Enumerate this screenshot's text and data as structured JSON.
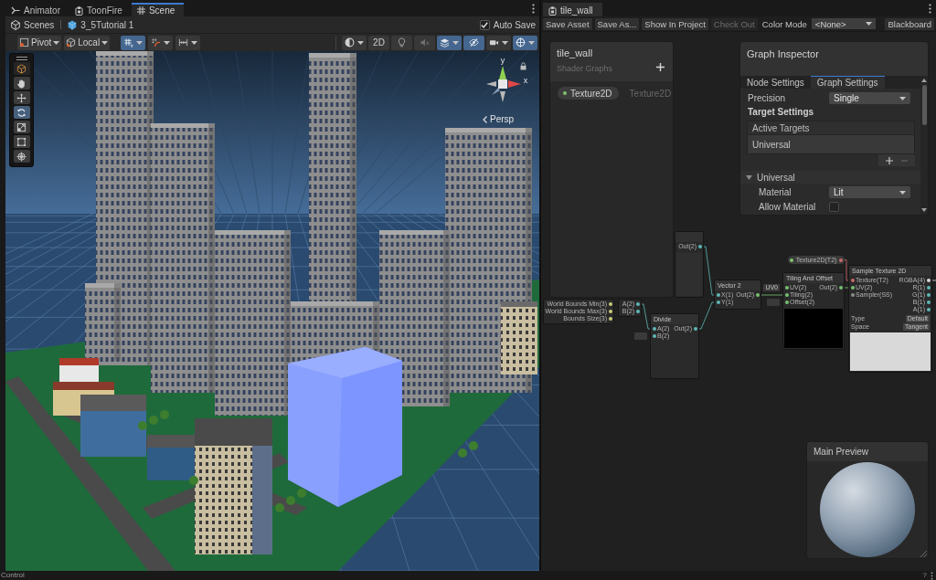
{
  "left_pane": {
    "focused": true,
    "tabs": [
      {
        "label": "Animator",
        "selected": false
      },
      {
        "label": "ToonFire",
        "selected": false
      },
      {
        "label": "Scene",
        "selected": true
      }
    ],
    "breadcrumbs": [
      "Scenes",
      "3_5Tutorial 1"
    ],
    "auto_save": {
      "label": "Auto Save",
      "checked": true
    },
    "toolbar_left": [
      {
        "kind": "dropdown",
        "label": "Pivot"
      },
      {
        "kind": "dropdown",
        "label": "Local"
      },
      {
        "kind": "icon",
        "on": true,
        "caret": true
      },
      {
        "kind": "icon",
        "on": false,
        "caret": true
      },
      {
        "kind": "icon",
        "on": false,
        "caret": true
      }
    ],
    "toolbar_right": [
      {
        "kind": "icon",
        "on": false,
        "caret": true
      },
      {
        "kind": "text",
        "label": "2D",
        "on": false,
        "caret": false
      },
      {
        "kind": "icon",
        "on": false,
        "caret": false
      },
      {
        "kind": "icon",
        "on": false,
        "caret": false
      },
      {
        "kind": "icon",
        "on": true,
        "caret": true
      },
      {
        "kind": "icon",
        "on": true,
        "caret": false
      },
      {
        "kind": "icon",
        "on": false,
        "caret": true
      },
      {
        "kind": "icon",
        "on": true,
        "caret": true
      }
    ],
    "tools": [
      {
        "selected": false
      },
      {
        "selected": false
      },
      {
        "selected": false
      },
      {
        "selected": true
      },
      {
        "selected": false
      },
      {
        "selected": false
      },
      {
        "selected": false
      }
    ],
    "gizmo": {
      "axes": [
        "y",
        "x"
      ],
      "projection": "Persp"
    }
  },
  "right_pane": {
    "focused": false,
    "tabs": [
      {
        "label": "tile_wall",
        "selected": true
      }
    ],
    "toolbar": [
      {
        "kind": "button",
        "label": "Save Asset",
        "disabled": false
      },
      {
        "kind": "button",
        "label": "Save As...",
        "disabled": false
      },
      {
        "kind": "button",
        "label": "Show In Project",
        "disabled": false
      },
      {
        "kind": "button",
        "label": "Check Out",
        "disabled": true
      },
      {
        "kind": "label",
        "label": "Color Mode"
      },
      {
        "kind": "dropdown",
        "label": "<None>"
      },
      {
        "kind": "button",
        "label": "Blackboard",
        "disabled": false
      }
    ],
    "blackboard": {
      "title": "tile_wall",
      "subtitle": "Shader Graphs",
      "properties": [
        {
          "name": "Texture2D",
          "type": "Texture2D",
          "exposed": true
        }
      ]
    },
    "graph_inspector": {
      "title": "Graph Inspector",
      "tabs": [
        {
          "label": "Node Settings",
          "selected": false
        },
        {
          "label": "Graph Settings",
          "selected": true
        }
      ],
      "precision": {
        "label": "Precision",
        "value": "Single"
      },
      "target_settings": "Target Settings",
      "active_targets": {
        "header": "Active Targets",
        "items": [
          "Universal"
        ]
      },
      "universal": {
        "label": "Universal",
        "expanded": true,
        "fields": [
          {
            "kind": "dropdown",
            "label": "Material",
            "value": "Lit"
          },
          {
            "kind": "checkbox",
            "label": "Allow Material",
            "checked": false
          }
        ]
      }
    },
    "nodes": [
      {
        "kind": "fragment",
        "header": true,
        "outputs": [
          {
            "label": "Out(2)",
            "color": "#5fb7b7"
          }
        ],
        "preview": {
          "color": "#2f2f2f"
        }
      },
      {
        "kind": "fragment",
        "header": false,
        "outputs": [
          {
            "label": "World Bounds Min(3)",
            "color": "#c9cc7a"
          },
          {
            "label": "World Bounds Max(3)",
            "color": "#c9cc7a"
          },
          {
            "label": "Bounds Size(3)",
            "color": "#c9cc7a"
          }
        ]
      },
      {
        "kind": "fragment",
        "header": false,
        "outputs": [
          {
            "label": "A(2)",
            "color": "#5fb7b7"
          },
          {
            "label": "B(2)",
            "color": "#5fb7b7"
          }
        ]
      },
      {
        "kind": "node",
        "title": "Divide",
        "inputs": [
          {
            "label": "A(2)",
            "color": "#5fb7b7"
          },
          {
            "label": "B(2)",
            "color": "#5fb7b7",
            "field": true
          }
        ],
        "outputs": [
          {
            "label": "Out(2)",
            "color": "#5fb7b7"
          }
        ]
      },
      {
        "kind": "node",
        "title": "Vector 2",
        "inputs": [
          {
            "label": "X(1)",
            "color": "#5fb7b7"
          },
          {
            "label": "Y(1)",
            "color": "#5fb7b7"
          }
        ],
        "outputs": [
          {
            "label": "Out(2)",
            "color": "#78c070"
          }
        ]
      },
      {
        "kind": "node",
        "title": "Tiling And Offset",
        "inputs": [
          {
            "label": "UV(2)",
            "color": "#78c070",
            "field": "UV0"
          },
          {
            "label": "Tiling(2)",
            "color": "#78c070"
          },
          {
            "label": "Offset(2)",
            "color": "#78c070",
            "field": true
          }
        ],
        "outputs": [
          {
            "label": "Out(2)",
            "color": "#78c070"
          }
        ],
        "preview": {
          "color": "#000000"
        }
      },
      {
        "kind": "node",
        "title": "Sample Texture 2D",
        "inputs": [
          {
            "label": "Texture(T2)",
            "color": "#c86868"
          },
          {
            "label": "UV(2)",
            "color": "#78c070"
          },
          {
            "label": "Sampler(SS)",
            "color": "#8c8c8c"
          }
        ],
        "outputs": [
          {
            "label": "RGBA(4)",
            "color": "#d8d8d8"
          },
          {
            "label": "R(1)",
            "color": "#5fb7b7"
          },
          {
            "label": "G(1)",
            "color": "#5fb7b7"
          },
          {
            "label": "B(1)",
            "color": "#5fb7b7"
          },
          {
            "label": "A(1)",
            "color": "#5fb7b7"
          }
        ],
        "settings": [
          {
            "label": "Type",
            "value": "Default"
          },
          {
            "label": "Space",
            "value": "Tangent"
          }
        ],
        "preview": {
          "color": "#d9d9d9"
        }
      },
      {
        "kind": "property",
        "title": "Texture2D(T2)",
        "exposed": true,
        "outputs": [
          {
            "color": "#c86868"
          }
        ]
      }
    ],
    "main_preview": {
      "title": "Main Preview"
    }
  },
  "status_bar": {
    "text": "Control",
    "help": "?"
  }
}
